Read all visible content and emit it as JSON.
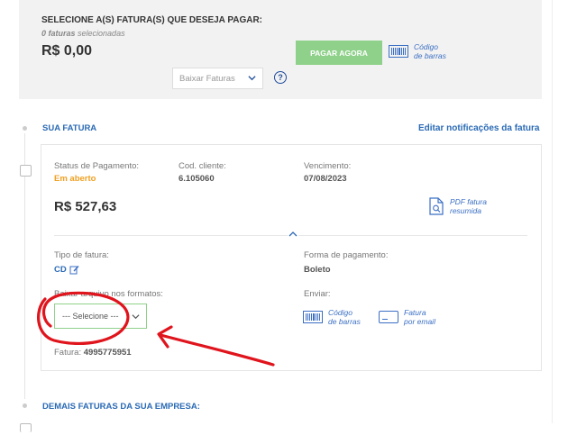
{
  "top": {
    "title": "SELECIONE A(S) FATURA(S) QUE DESEJA PAGAR:",
    "count_bold": "0 faturas",
    "count_rest": " selecionadas",
    "amount": "R$ 0,00",
    "pay_button": "PAGAR AGORA",
    "barcode_line1": "Código",
    "barcode_line2": "de barras",
    "download_select": "Baixar Faturas",
    "help": "?"
  },
  "invoice": {
    "section_title": "SUA FATURA",
    "edit_notifications": "Editar notificações da fatura",
    "status_label": "Status de Pagamento:",
    "status_value": "Em aberto",
    "client_label": "Cod. cliente:",
    "client_value": "6.105060",
    "due_label": "Vencimento:",
    "due_value": "07/08/2023",
    "amount": "R$ 527,63",
    "pdf_line1": "PDF fatura",
    "pdf_line2": "resumida",
    "type_label": "Tipo de fatura:",
    "type_value": "CD",
    "payment_label": "Forma de pagamento:",
    "payment_value": "Boleto",
    "formats_label": "Baixar arquivo nos formatos:",
    "formats_select": "--- Selecione ---",
    "send_label": "Enviar:",
    "send_barcode_line1": "Código",
    "send_barcode_line2": "de barras",
    "send_email_line1": "Fatura",
    "send_email_line2": "por email",
    "fatura_label": "Fatura: ",
    "fatura_number": "4995775951"
  },
  "others": {
    "section_title": "DEMAIS FATURAS DA SUA EMPRESA:"
  },
  "colors": {
    "accent_blue": "#2a6ab5",
    "pay_green": "#8fd18a",
    "status_orange": "#f0a020",
    "annotation_red": "#e0141c"
  }
}
